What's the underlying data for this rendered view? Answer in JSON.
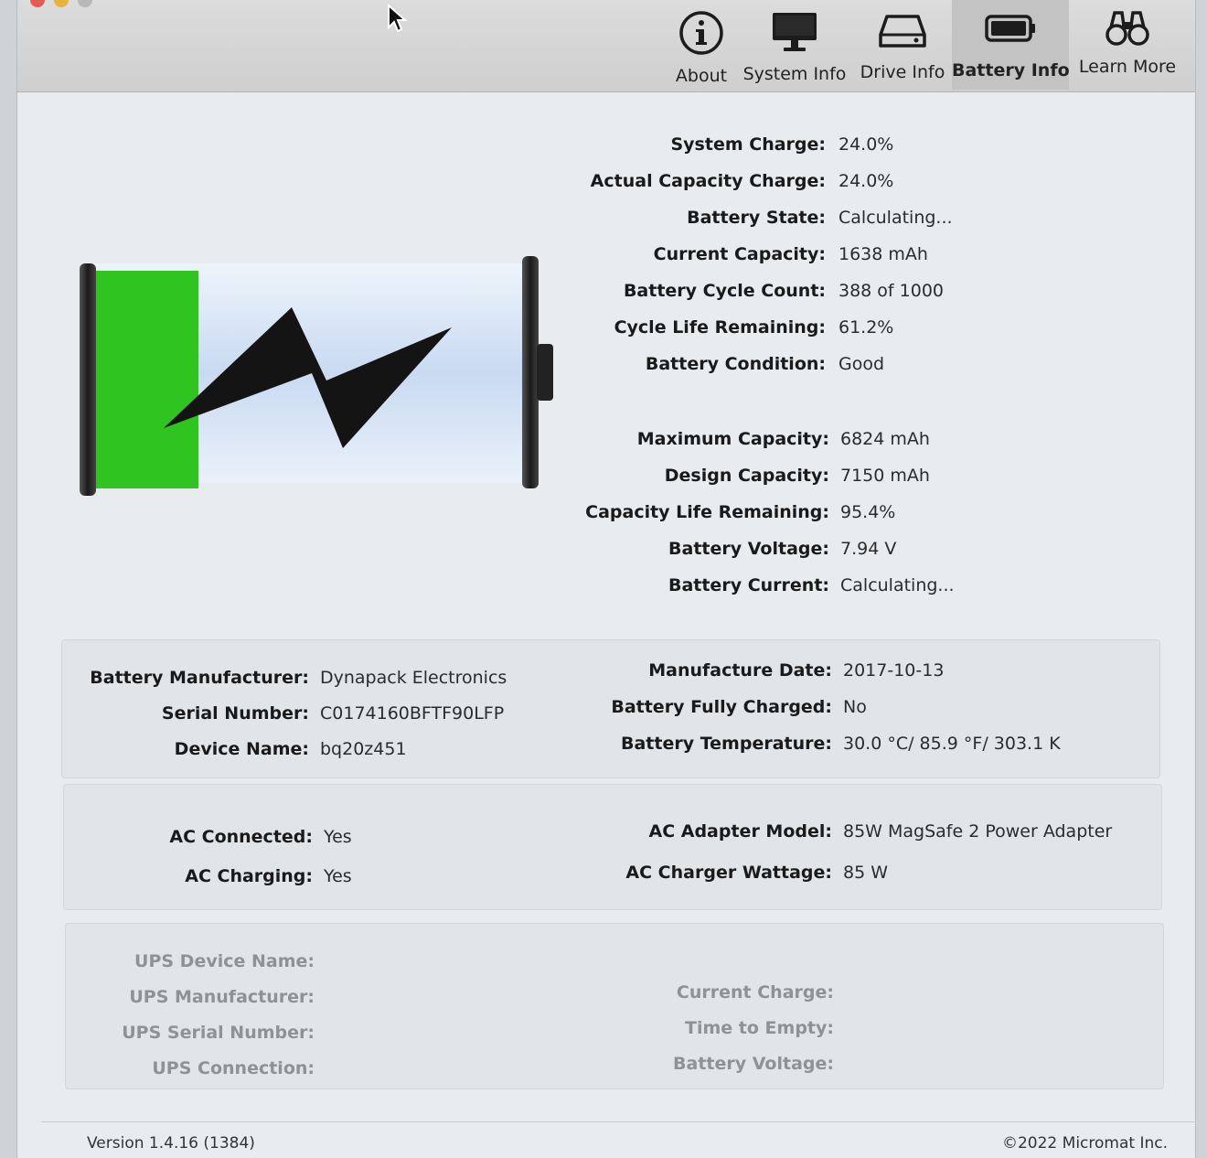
{
  "toolbar": {
    "items": [
      {
        "label": "About",
        "icon": "info-icon"
      },
      {
        "label": "System Info",
        "icon": "monitor-icon"
      },
      {
        "label": "Drive Info",
        "icon": "drive-icon"
      },
      {
        "label": "Battery Info",
        "icon": "battery-icon",
        "active": true
      },
      {
        "label": "Learn More",
        "icon": "binoculars-icon"
      }
    ]
  },
  "battery_graphic": {
    "charge_fraction": 0.24,
    "fill_color": "#2fc41f",
    "charging": true
  },
  "stats1": [
    {
      "label": "System Charge:",
      "value": "24.0%"
    },
    {
      "label": "Actual Capacity Charge:",
      "value": "24.0%"
    },
    {
      "label": "Battery State:",
      "value": "Calculating..."
    },
    {
      "label": "Current Capacity:",
      "value": "1638 mAh"
    },
    {
      "label": "Battery Cycle Count:",
      "value": "388 of 1000"
    },
    {
      "label": "Cycle Life Remaining:",
      "value": "61.2%"
    },
    {
      "label": "Battery Condition:",
      "value": "Good"
    }
  ],
  "stats2": [
    {
      "label": "Maximum Capacity:",
      "value": "6824 mAh"
    },
    {
      "label": "Design Capacity:",
      "value": "7150 mAh"
    },
    {
      "label": "Capacity Life Remaining:",
      "value": "95.4%"
    },
    {
      "label": "Battery Voltage:",
      "value": "7.94 V"
    },
    {
      "label": "Battery Current:",
      "value": "Calculating..."
    }
  ],
  "panel_battery": {
    "left": [
      {
        "label": "Battery Manufacturer:",
        "value": "Dynapack Electronics"
      },
      {
        "label": "Serial Number:",
        "value": "C0174160BFTF90LFP"
      },
      {
        "label": "Device Name:",
        "value": "bq20z451"
      }
    ],
    "right": [
      {
        "label": "Manufacture Date:",
        "value": "2017-10-13"
      },
      {
        "label": "Battery Fully Charged:",
        "value": "No"
      },
      {
        "label": "Battery Temperature:",
        "value": "30.0 °C/ 85.9 °F/ 303.1 K"
      }
    ]
  },
  "panel_ac": {
    "left": [
      {
        "label": "AC Connected:",
        "value": "Yes"
      },
      {
        "label": "AC Charging:",
        "value": "Yes"
      }
    ],
    "right": [
      {
        "label": "AC Adapter Model:",
        "value": "85W MagSafe 2 Power Adapter"
      },
      {
        "label": "AC Charger Wattage:",
        "value": "85 W"
      }
    ]
  },
  "panel_ups": {
    "left": [
      {
        "label": "UPS Device Name:",
        "value": ""
      },
      {
        "label": "UPS Manufacturer:",
        "value": ""
      },
      {
        "label": "UPS Serial Number:",
        "value": ""
      },
      {
        "label": "UPS Connection:",
        "value": ""
      }
    ],
    "right": [
      {
        "label": "Current Charge:",
        "value": ""
      },
      {
        "label": "Time to Empty:",
        "value": ""
      },
      {
        "label": "Battery Voltage:",
        "value": ""
      }
    ]
  },
  "footer": {
    "version": "Version 1.4.16 (1384)",
    "copyright": "©2022 Micromat Inc."
  }
}
